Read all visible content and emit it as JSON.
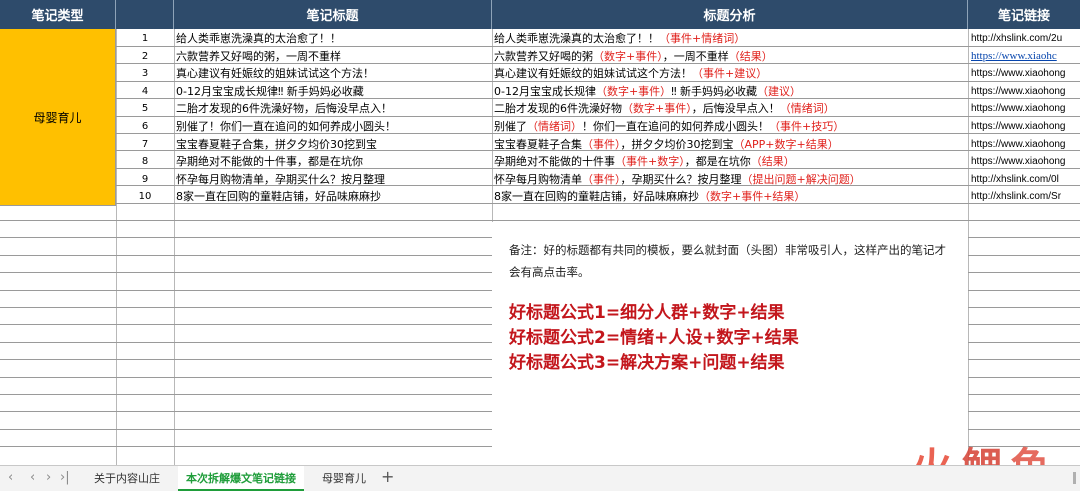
{
  "headers": {
    "category": "笔记类型",
    "title": "笔记标题",
    "analysis": "标题分析",
    "link": "笔记链接"
  },
  "category_label": "母婴育儿",
  "rows": [
    {
      "num": "1",
      "title": "给人类乖崽洗澡真的太治愈了！！",
      "analysis": [
        {
          "t": "给人类乖崽洗澡真的太治愈了！！"
        },
        {
          "t": "（事件+情绪词）",
          "red": true
        }
      ],
      "link": "http://xhslink.com/2u",
      "link_style": "plain"
    },
    {
      "num": "2",
      "title": "六款营养又好喝的粥，一周不重样",
      "analysis": [
        {
          "t": "六款营养又好喝的粥"
        },
        {
          "t": "（数字+事件）",
          "red": true
        },
        {
          "t": "，一周不重样"
        },
        {
          "t": "（结果）",
          "red": true
        }
      ],
      "link": "https://www.xiaohc",
      "link_style": "underline"
    },
    {
      "num": "3",
      "title": "真心建议有妊娠纹的姐妹试试这个方法！",
      "analysis": [
        {
          "t": "真心建议有妊娠纹的姐妹试试这个方法！"
        },
        {
          "t": "（事件+建议）",
          "red": true
        }
      ],
      "link": "https://www.xiaohong",
      "link_style": "plain"
    },
    {
      "num": "4",
      "title": "0-12月宝宝成长规律‼ 新手妈妈必收藏",
      "analysis": [
        {
          "t": "0-12月宝宝成长规律"
        },
        {
          "t": "（数字+事件）",
          "red": true
        },
        {
          "t": "‼ 新手妈妈必收藏"
        },
        {
          "t": "（建议）",
          "red": true
        }
      ],
      "link": "https://www.xiaohong",
      "link_style": "plain"
    },
    {
      "num": "5",
      "title": "二胎才发现的6件洗澡好物，后悔没早点入！",
      "analysis": [
        {
          "t": "二胎才发现的6件洗澡好物"
        },
        {
          "t": "（数字+事件）",
          "red": true
        },
        {
          "t": "，后悔没早点入！"
        },
        {
          "t": "（情绪词）",
          "red": true
        }
      ],
      "link": "https://www.xiaohong",
      "link_style": "plain"
    },
    {
      "num": "6",
      "title": "别催了！你们一直在追问的如何养成小圆头！",
      "analysis": [
        {
          "t": "别催了"
        },
        {
          "t": "（情绪词）",
          "red": true
        },
        {
          "t": "！你们一直在追问的如何养成小圆头！"
        },
        {
          "t": "（事件+技巧）",
          "red": true
        }
      ],
      "link": "https://www.xiaohong",
      "link_style": "plain"
    },
    {
      "num": "7",
      "title": "宝宝春夏鞋子合集，拼夕夕均价30挖到宝",
      "analysis": [
        {
          "t": "宝宝春夏鞋子合集"
        },
        {
          "t": "（事件）",
          "red": true
        },
        {
          "t": "，拼夕夕均价30挖到宝"
        },
        {
          "t": "（APP+数字+结果）",
          "red": true
        }
      ],
      "link": "https://www.xiaohong",
      "link_style": "plain"
    },
    {
      "num": "8",
      "title": "孕期绝对不能做的十件事，都是在坑你",
      "analysis": [
        {
          "t": "孕期绝对不能做的十件事"
        },
        {
          "t": "（事件+数字）",
          "red": true
        },
        {
          "t": "，都是在坑你"
        },
        {
          "t": "（结果）",
          "red": true
        }
      ],
      "link": "https://www.xiaohong",
      "link_style": "plain"
    },
    {
      "num": "9",
      "title": "怀孕每月购物清单，孕期买什么？按月整理",
      "analysis": [
        {
          "t": "怀孕每月购物清单"
        },
        {
          "t": "（事件）",
          "red": true
        },
        {
          "t": "，孕期买什么？按月整理"
        },
        {
          "t": "（提出问题+解决问题）",
          "red": true
        }
      ],
      "link": "http://xhslink.com/0l",
      "link_style": "plain"
    },
    {
      "num": "10",
      "title": "8家一直在回购的童鞋店铺，好品味麻麻抄",
      "analysis": [
        {
          "t": "8家一直在回购的童鞋店铺，好品味麻麻抄"
        },
        {
          "t": "（数字+事件+结果）",
          "red": true
        }
      ],
      "link": "http://xhslink.com/Sr",
      "link_style": "plain"
    }
  ],
  "note": {
    "remark": "备注：好的标题都有共同的模板，要么就封面（头图）非常吸引人，这样产出的笔记才会有高点击率。",
    "formula1": "好标题公式1=细分人群+数字+结果",
    "formula2": "好标题公式2=情绪+人设+数字+结果",
    "formula3": "好标题公式3=解决方案+问题+结果"
  },
  "tabs": [
    "关于内容山庄",
    "本次拆解爆文笔记链接",
    "母婴育儿"
  ],
  "active_tab": 1,
  "nav_icons": [
    "first-sheet-icon",
    "prev-sheet-icon",
    "next-sheet-icon",
    "last-sheet-icon"
  ],
  "add_tab": "+",
  "logo_text": [
    "火",
    "鲤",
    "鱼"
  ],
  "colors": {
    "header_bg": "#2e4b6b",
    "category_bg": "#ffc000",
    "annotation_red": "#e0201b",
    "formula_red": "#c3161c",
    "active_tab": "#1f9d3a"
  }
}
